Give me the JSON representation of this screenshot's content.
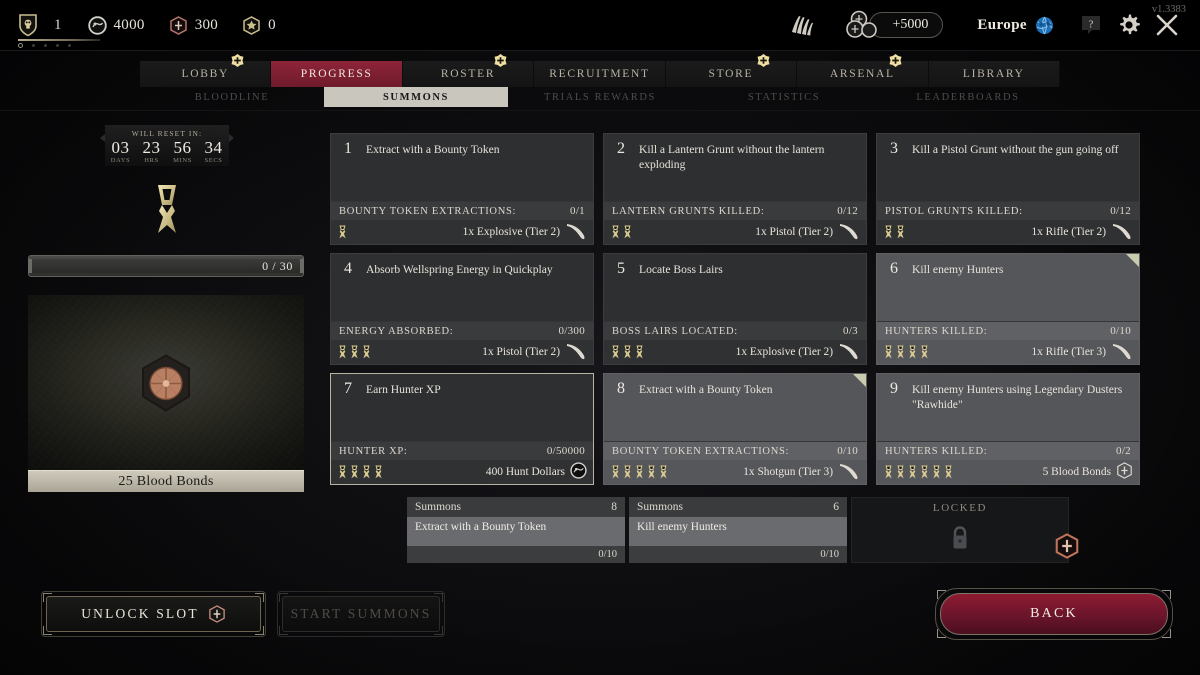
{
  "topbar": {
    "version": "v1.3383",
    "currencies": [
      {
        "icon": "rank-shield-icon",
        "value": "1"
      },
      {
        "icon": "hunt-dollars-icon",
        "value": "4000"
      },
      {
        "icon": "blood-bonds-icon",
        "value": "300"
      },
      {
        "icon": "event-points-icon",
        "value": "0"
      }
    ],
    "bloodbonds_add": "+5000",
    "region": "Europe",
    "icons": {
      "claw": "claw-icon",
      "globe": "globe-icon",
      "help": "help-icon",
      "settings": "gear-icon",
      "close": "close-icon"
    }
  },
  "nav": {
    "tabs": [
      {
        "label": "LOBBY",
        "active": false,
        "badge": true
      },
      {
        "label": "PROGRESS",
        "active": true,
        "badge": false
      },
      {
        "label": "ROSTER",
        "active": false,
        "badge": true
      },
      {
        "label": "RECRUITMENT",
        "active": false,
        "badge": false
      },
      {
        "label": "STORE",
        "active": false,
        "badge": true
      },
      {
        "label": "ARSENAL",
        "active": false,
        "badge": true
      },
      {
        "label": "LIBRARY",
        "active": false,
        "badge": false
      }
    ],
    "subtabs": [
      {
        "label": "BLOODLINE",
        "active": false
      },
      {
        "label": "SUMMONS",
        "active": true
      },
      {
        "label": "TRIALS REWARDS",
        "active": false
      },
      {
        "label": "STATISTICS",
        "active": false
      },
      {
        "label": "LEADERBOARDS",
        "active": false
      }
    ]
  },
  "left": {
    "reset_label": "WILL RESET IN:",
    "timer": [
      {
        "num": "03",
        "label": "DAYS"
      },
      {
        "num": "23",
        "label": "HRS"
      },
      {
        "num": "56",
        "label": "MINS"
      },
      {
        "num": "34",
        "label": "SECS"
      }
    ],
    "progress_text": "0 / 30",
    "progress_percent": 0,
    "reward_label": "25 Blood Bonds"
  },
  "challenges": [
    {
      "num": "1",
      "desc": "Extract with a Bounty Token",
      "objective": "BOUNTY TOKEN EXTRACTIONS:",
      "count": "0/1",
      "stars": 1,
      "reward": "1x Explosive (Tier 2)",
      "reward_icon": "pistol-icon",
      "highlight": false,
      "selected": false,
      "corner": false
    },
    {
      "num": "2",
      "desc": "Kill a Lantern Grunt without the lantern exploding",
      "objective": "LANTERN GRUNTS KILLED:",
      "count": "0/12",
      "stars": 2,
      "reward": "1x Pistol (Tier 2)",
      "reward_icon": "pistol-icon",
      "highlight": false,
      "selected": false,
      "corner": false
    },
    {
      "num": "3",
      "desc": "Kill a Pistol Grunt without the gun going off",
      "objective": "PISTOL GRUNTS KILLED:",
      "count": "0/12",
      "stars": 2,
      "reward": "1x Rifle (Tier 2)",
      "reward_icon": "pistol-icon",
      "highlight": false,
      "selected": false,
      "corner": false
    },
    {
      "num": "4",
      "desc": "Absorb Wellspring Energy in Quickplay",
      "objective": "ENERGY ABSORBED:",
      "count": "0/300",
      "stars": 3,
      "reward": "1x Pistol (Tier 2)",
      "reward_icon": "pistol-icon",
      "highlight": false,
      "selected": false,
      "corner": false
    },
    {
      "num": "5",
      "desc": "Locate Boss Lairs",
      "objective": "BOSS LAIRS LOCATED:",
      "count": "0/3",
      "stars": 3,
      "reward": "1x Explosive (Tier 2)",
      "reward_icon": "pistol-icon",
      "highlight": false,
      "selected": false,
      "corner": false
    },
    {
      "num": "6",
      "desc": "Kill enemy Hunters",
      "objective": "HUNTERS KILLED:",
      "count": "0/10",
      "stars": 4,
      "reward": "1x Rifle (Tier 3)",
      "reward_icon": "pistol-icon",
      "highlight": true,
      "selected": false,
      "corner": true
    },
    {
      "num": "7",
      "desc": "Earn Hunter XP",
      "objective": "HUNTER XP:",
      "count": "0/50000",
      "stars": 4,
      "reward": "400 Hunt Dollars",
      "reward_icon": "hunt-dollars-icon",
      "highlight": false,
      "selected": true,
      "corner": false
    },
    {
      "num": "8",
      "desc": "Extract with a Bounty Token",
      "objective": "BOUNTY TOKEN EXTRACTIONS:",
      "count": "0/10",
      "stars": 5,
      "reward": "1x Shotgun (Tier 3)",
      "reward_icon": "pistol-icon",
      "highlight": true,
      "selected": false,
      "corner": true
    },
    {
      "num": "9",
      "desc": "Kill enemy Hunters using Legendary Dusters \"Rawhide\"",
      "objective": "HUNTERS KILLED:",
      "count": "0/2",
      "stars": 6,
      "reward": "5 Blood Bonds",
      "reward_icon": "blood-bonds-icon",
      "highlight": true,
      "selected": false,
      "corner": false
    }
  ],
  "slots": [
    {
      "title": "Summons",
      "num": "8",
      "desc": "Extract with a Bounty Token",
      "count": "0/10",
      "locked": false
    },
    {
      "title": "Summons",
      "num": "6",
      "desc": "Kill enemy Hunters",
      "count": "0/10",
      "locked": false
    },
    {
      "title": "LOCKED",
      "num": "",
      "desc": "",
      "count": "",
      "locked": true
    }
  ],
  "buttons": {
    "unlock_slot": "UNLOCK SLOT",
    "start_summons": "START SUMMONS",
    "back": "BACK"
  },
  "colors": {
    "accent_red": "#8e2438",
    "gold": "#c9bd8f",
    "card_bg": "#2e2f31",
    "card_bg_light": "#55565a"
  }
}
